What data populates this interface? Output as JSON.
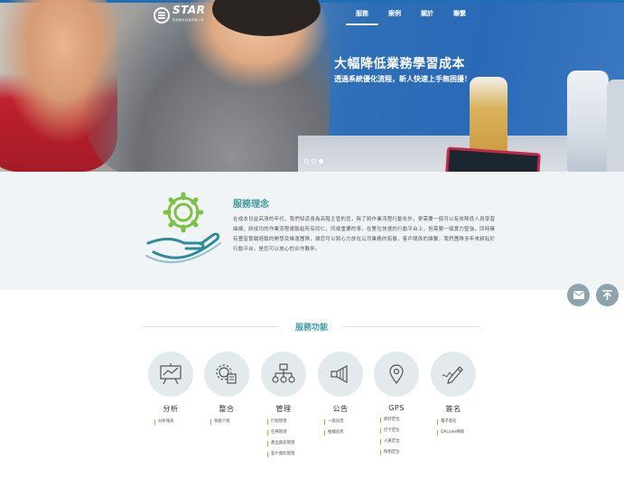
{
  "brand": {
    "logo_text": "STAR",
    "logo_sub": "百奇數位科技有限公司"
  },
  "nav": [
    {
      "label": "服務"
    },
    {
      "label": "案例"
    },
    {
      "label": "關於"
    },
    {
      "label": "聯繫"
    }
  ],
  "hero": {
    "headline": "大幅降低業務學習成本",
    "subline": "透過系統優化流程，新人快速上手無困擾！",
    "slide_count": 3,
    "active_slide": 3
  },
  "philosophy": {
    "title": "服務理念",
    "body": "在成本日益高漲的年代，我們知道身為高階主管的您，除了將作業流程行動化外，更需要一個可以有效降低人員學習曲線，將成功的作業流程複製給所有同仁，同樣重要的事，在雙位快速的行動平台上，但需要一個實力堅強，同時擁有豐富實戰經驗的開發及維運團隊，讓您可以將心力放在公司業務的拓展，客戶關係的維繫，我們團隊多年來耕耘於行動平台，是您可以放心的合作夥伴。"
  },
  "float_buttons": {
    "mail_icon": "mail-icon",
    "top_icon": "back-to-top-icon"
  },
  "services": {
    "title": "服務功能",
    "items": [
      {
        "name": "分析",
        "icon": "chart-board-icon",
        "links": [
          "分析報表"
        ]
      },
      {
        "name": "整合",
        "icon": "gear-document-icon",
        "links": [
          "系統介接"
        ]
      },
      {
        "name": "管理",
        "icon": "org-chart-icon",
        "links": [
          "行程管理",
          "任務管理",
          "產品資訊管理",
          "客戶資料管理"
        ]
      },
      {
        "name": "公告",
        "icon": "megaphone-icon",
        "links": [
          "一般訊息",
          "推播訊息"
        ]
      },
      {
        "name": "GPS",
        "icon": "map-pin-icon",
        "links": [
          "即時定位",
          "打卡定位",
          "人員定位",
          "照相定位"
        ]
      },
      {
        "name": "簽名",
        "icon": "signature-pen-icon",
        "links": [
          "電子簽名",
          "QRcode條碼"
        ]
      }
    ]
  },
  "colors": {
    "accent": "#3f9b9f",
    "link_marker": "#8bc34a",
    "hero_blue": "#2a69b6",
    "section_bg": "#f0f4f6",
    "fab_bg": "#8ea3ac"
  }
}
